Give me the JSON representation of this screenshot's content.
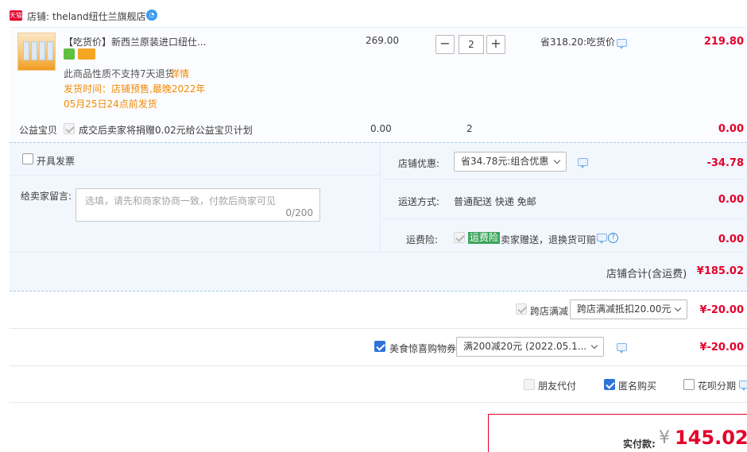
{
  "store": {
    "badge": "天猫",
    "label": "店铺:",
    "name": "theland纽仕兰旗舰店"
  },
  "item": {
    "title": "【吃货价】新西兰原装进口纽仕...",
    "price": "269.00",
    "quantity": "2",
    "discount_note": "省318.20:吃货价",
    "subtotal": "219.80",
    "return_note": "此商品性质不支持7天退货",
    "return_link": "详情",
    "ship_line1": "发货时间：店铺预售,最晚2022年",
    "ship_line2": "05月25日24点前发货",
    "minus": "−",
    "plus": "+"
  },
  "charity": {
    "label": "公益宝贝",
    "text": "成交后卖家将捐赠0.02元给公益宝贝计划",
    "price": "0.00",
    "qty": "2",
    "total": "0.00"
  },
  "invoice": {
    "label": "开具发票"
  },
  "message": {
    "label": "给卖家留言:",
    "placeholder": "选填，请先和商家协商一致，付款后商家可见",
    "counter": "0/200"
  },
  "store_discount": {
    "label": "店铺优惠:",
    "selected": "省34.78元:组合优惠",
    "amount": "-34.78"
  },
  "shipping": {
    "label": "运送方式:",
    "value": "普通配送 快递 免邮",
    "amount": "0.00"
  },
  "insurance": {
    "label": "运费险:",
    "tag": "运费险",
    "text": "卖家赠送，退换货可赔",
    "amount": "0.00"
  },
  "store_total": {
    "label": "店铺合计(含运费)",
    "amount": "¥185.02"
  },
  "cross_store": {
    "label": "跨店满减",
    "selected": "跨店满减抵扣20.00元",
    "amount": "¥-20.00"
  },
  "coupon": {
    "label": "美食惊喜购物券",
    "selected": "满200减20元 (2022.05.1...",
    "amount": "¥-20.00"
  },
  "options": {
    "friend_pay": "朋友代付",
    "anonymous": "匿名购买",
    "huabei": "花呗分期"
  },
  "payment": {
    "label": "实付款:",
    "currency": "¥",
    "amount": "145.02"
  },
  "colors": {
    "accent_red": "#e4002b",
    "blue": "#2f73da",
    "orange": "#f28a07",
    "panel_blue": "#f2f7fd"
  }
}
